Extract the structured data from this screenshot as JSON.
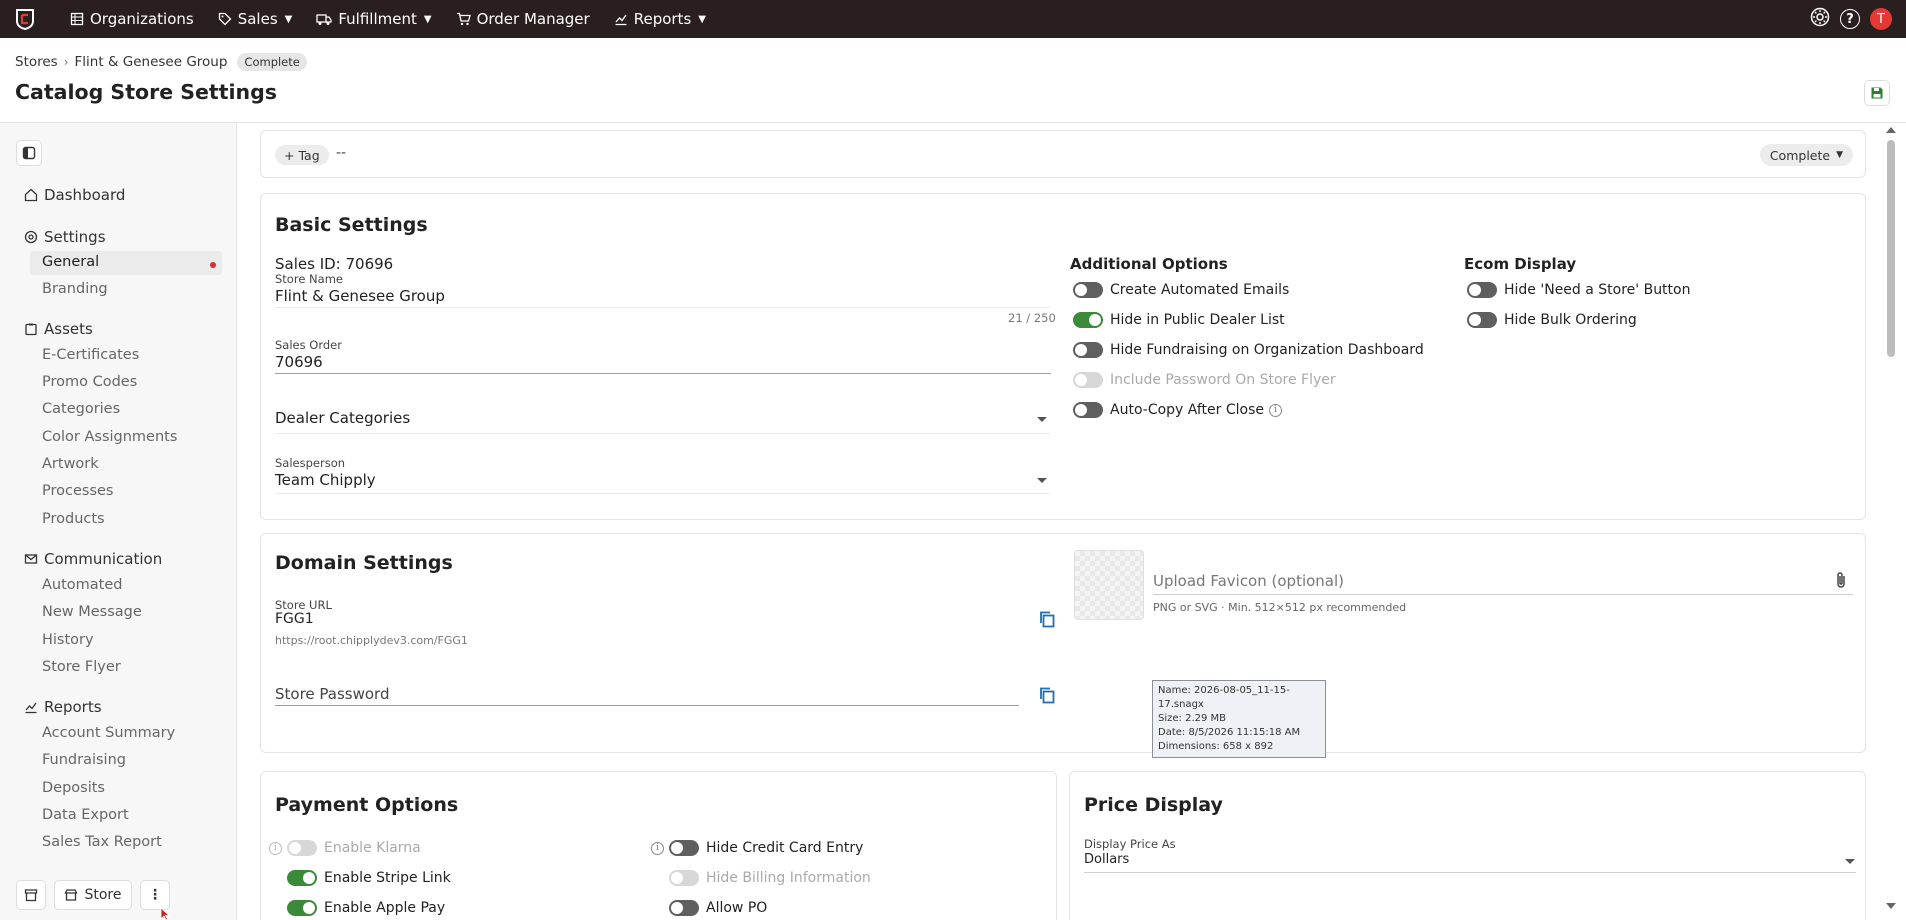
{
  "topnav": {
    "items": [
      {
        "label": "Organizations",
        "icon": "building-icon"
      },
      {
        "label": "Sales",
        "icon": "tag-icon",
        "dropdown": true
      },
      {
        "label": "Fulfillment",
        "icon": "truck-icon",
        "dropdown": true
      },
      {
        "label": "Order Manager",
        "icon": "cart-icon"
      },
      {
        "label": "Reports",
        "icon": "chart-icon",
        "dropdown": true
      }
    ],
    "avatar_letter": "T",
    "help_glyph": "?"
  },
  "breadcrumb": {
    "root": "Stores",
    "current": "Flint & Genesee Group",
    "badge": "Complete"
  },
  "page_title": "Catalog Store Settings",
  "sidebar": {
    "dashboard": "Dashboard",
    "settings": {
      "label": "Settings",
      "items": [
        "General",
        "Branding"
      ],
      "active": "General"
    },
    "assets": {
      "label": "Assets",
      "items": [
        "E-Certificates",
        "Promo Codes",
        "Categories",
        "Color Assignments",
        "Artwork",
        "Processes",
        "Products"
      ]
    },
    "communication": {
      "label": "Communication",
      "items": [
        "Automated",
        "New Message",
        "History",
        "Store Flyer"
      ]
    },
    "reports": {
      "label": "Reports",
      "items": [
        "Account Summary",
        "Fundraising",
        "Deposits",
        "Data Export",
        "Sales Tax Report"
      ]
    },
    "footer": {
      "store_label": "Store"
    }
  },
  "tag_bar": {
    "tag_label": "Tag",
    "tag_value": "--",
    "status": "Complete"
  },
  "basic_settings": {
    "title": "Basic Settings",
    "sales_id": "Sales ID: 70696",
    "store_name_label": "Store Name",
    "store_name": "Flint & Genesee Group",
    "store_name_counter": "21 / 250",
    "sales_order_label": "Sales Order",
    "sales_order": "70696",
    "dealer_categories_placeholder": "Dealer Categories",
    "salesperson_label": "Salesperson",
    "salesperson": "Team Chipply",
    "additional_options": {
      "title": "Additional Options",
      "toggles": [
        {
          "label": "Create Automated Emails",
          "on": false,
          "disabled": false
        },
        {
          "label": "Hide in Public Dealer List",
          "on": true,
          "disabled": false
        },
        {
          "label": "Hide Fundraising on Organization Dashboard",
          "on": false,
          "disabled": false
        },
        {
          "label": "Include Password On Store Flyer",
          "on": false,
          "disabled": true
        },
        {
          "label": "Auto-Copy After Close",
          "on": false,
          "disabled": false
        }
      ]
    },
    "ecom_display": {
      "title": "Ecom Display",
      "toggles": [
        {
          "label": "Hide 'Need a Store' Button",
          "on": false
        },
        {
          "label": "Hide Bulk Ordering",
          "on": false
        }
      ]
    }
  },
  "domain_settings": {
    "title": "Domain Settings",
    "store_url_label": "Store URL",
    "store_url": "FGG1",
    "store_url_full": "https://root.chipplydev3.com/FGG1",
    "store_password_placeholder": "Store Password",
    "favicon_placeholder": "Upload Favicon (optional)",
    "favicon_hint": "PNG or SVG · Min. 512×512 px recommended"
  },
  "tooltip": {
    "name": "Name: 2026-08-05_11-15-17.snagx",
    "size": "Size: 2.29 MB",
    "date": "Date: 8/5/2026 11:15:18 AM",
    "dimensions": "Dimensions: 658 x 892"
  },
  "payment_options": {
    "title": "Payment Options",
    "left": [
      {
        "label": "Enable Klarna",
        "on": false,
        "disabled": true
      },
      {
        "label": "Enable Stripe Link",
        "on": true,
        "disabled": false
      },
      {
        "label": "Enable Apple Pay",
        "on": true,
        "disabled": false
      }
    ],
    "right": [
      {
        "label": "Hide Credit Card Entry",
        "on": false,
        "disabled": false
      },
      {
        "label": "Hide Billing Information",
        "on": false,
        "disabled": true
      },
      {
        "label": "Allow PO",
        "on": false,
        "disabled": false
      }
    ]
  },
  "price_display": {
    "title": "Price Display",
    "display_as_label": "Display Price As",
    "display_as": "Dollars"
  },
  "colors": {
    "topbar": "#2a1f1f",
    "toggle_on": "#3a8a3a",
    "accent_blue": "#1f6fb2",
    "avatar": "#e53935"
  }
}
